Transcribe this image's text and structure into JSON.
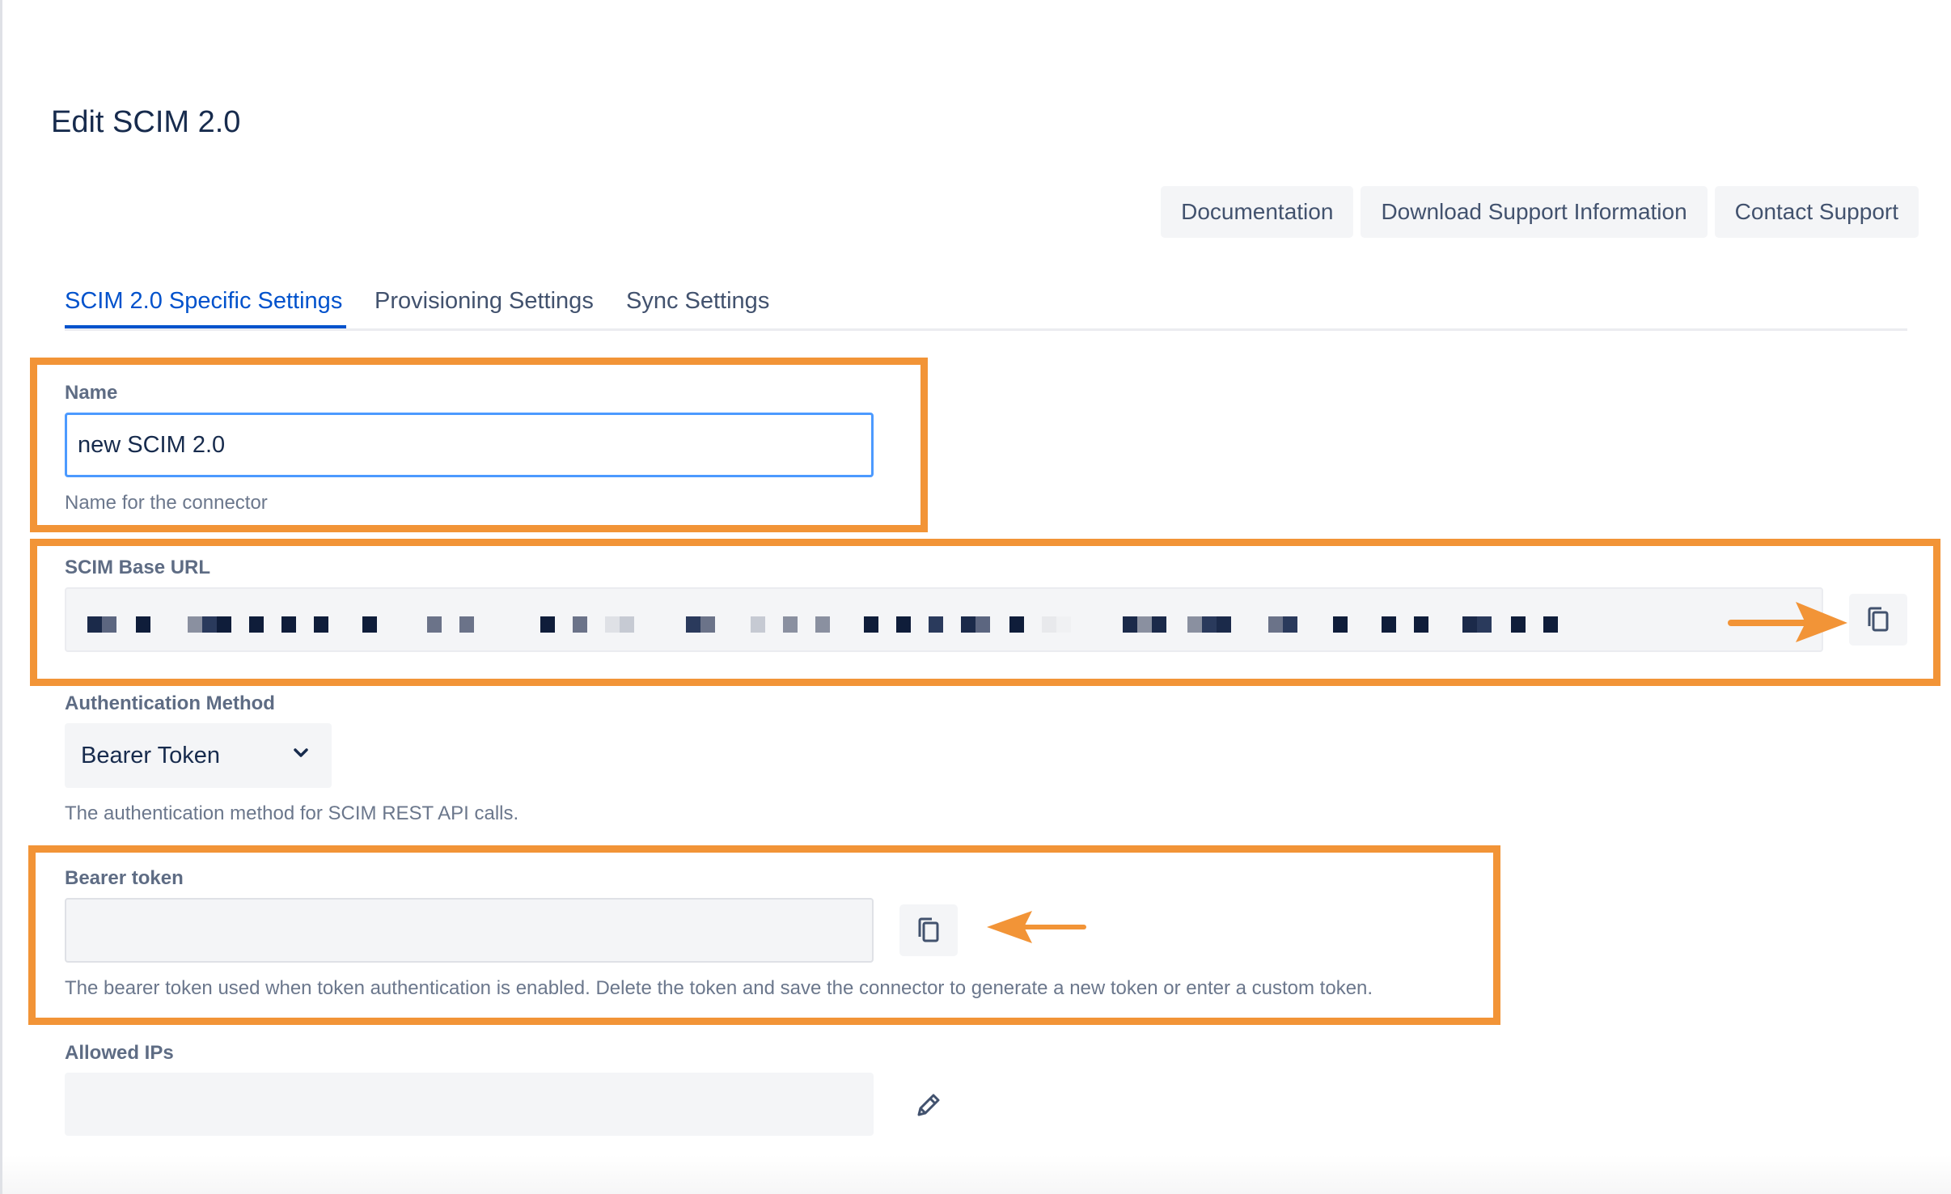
{
  "page": {
    "title": "Edit SCIM 2.0"
  },
  "actions": {
    "documentation": "Documentation",
    "download_support": "Download Support Information",
    "contact_support": "Contact Support"
  },
  "tabs": [
    {
      "label": "SCIM 2.0 Specific Settings",
      "active": true
    },
    {
      "label": "Provisioning Settings",
      "active": false
    },
    {
      "label": "Sync Settings",
      "active": false
    }
  ],
  "form": {
    "name": {
      "label": "Name",
      "value": "new SCIM 2.0",
      "help": "Name for the connector"
    },
    "base_url": {
      "label": "SCIM Base URL",
      "value_redacted": true,
      "copy_icon": "copy-icon"
    },
    "auth_method": {
      "label": "Authentication Method",
      "value": "Bearer Token",
      "help": "The authentication method for SCIM REST API calls."
    },
    "bearer_token": {
      "label": "Bearer token",
      "value": "",
      "help": "The bearer token used when token authentication is enabled. Delete the token and save the connector to generate a new token or enter a custom token.",
      "copy_icon": "copy-icon"
    },
    "allowed_ips": {
      "label": "Allowed IPs",
      "value": "",
      "edit_icon": "pencil-icon"
    }
  },
  "annotations": {
    "color": "#f29437"
  },
  "colors": {
    "accent": "#0052cc",
    "focus": "#4c9aff",
    "text": "#172b4d",
    "muted": "#5e6c84"
  }
}
